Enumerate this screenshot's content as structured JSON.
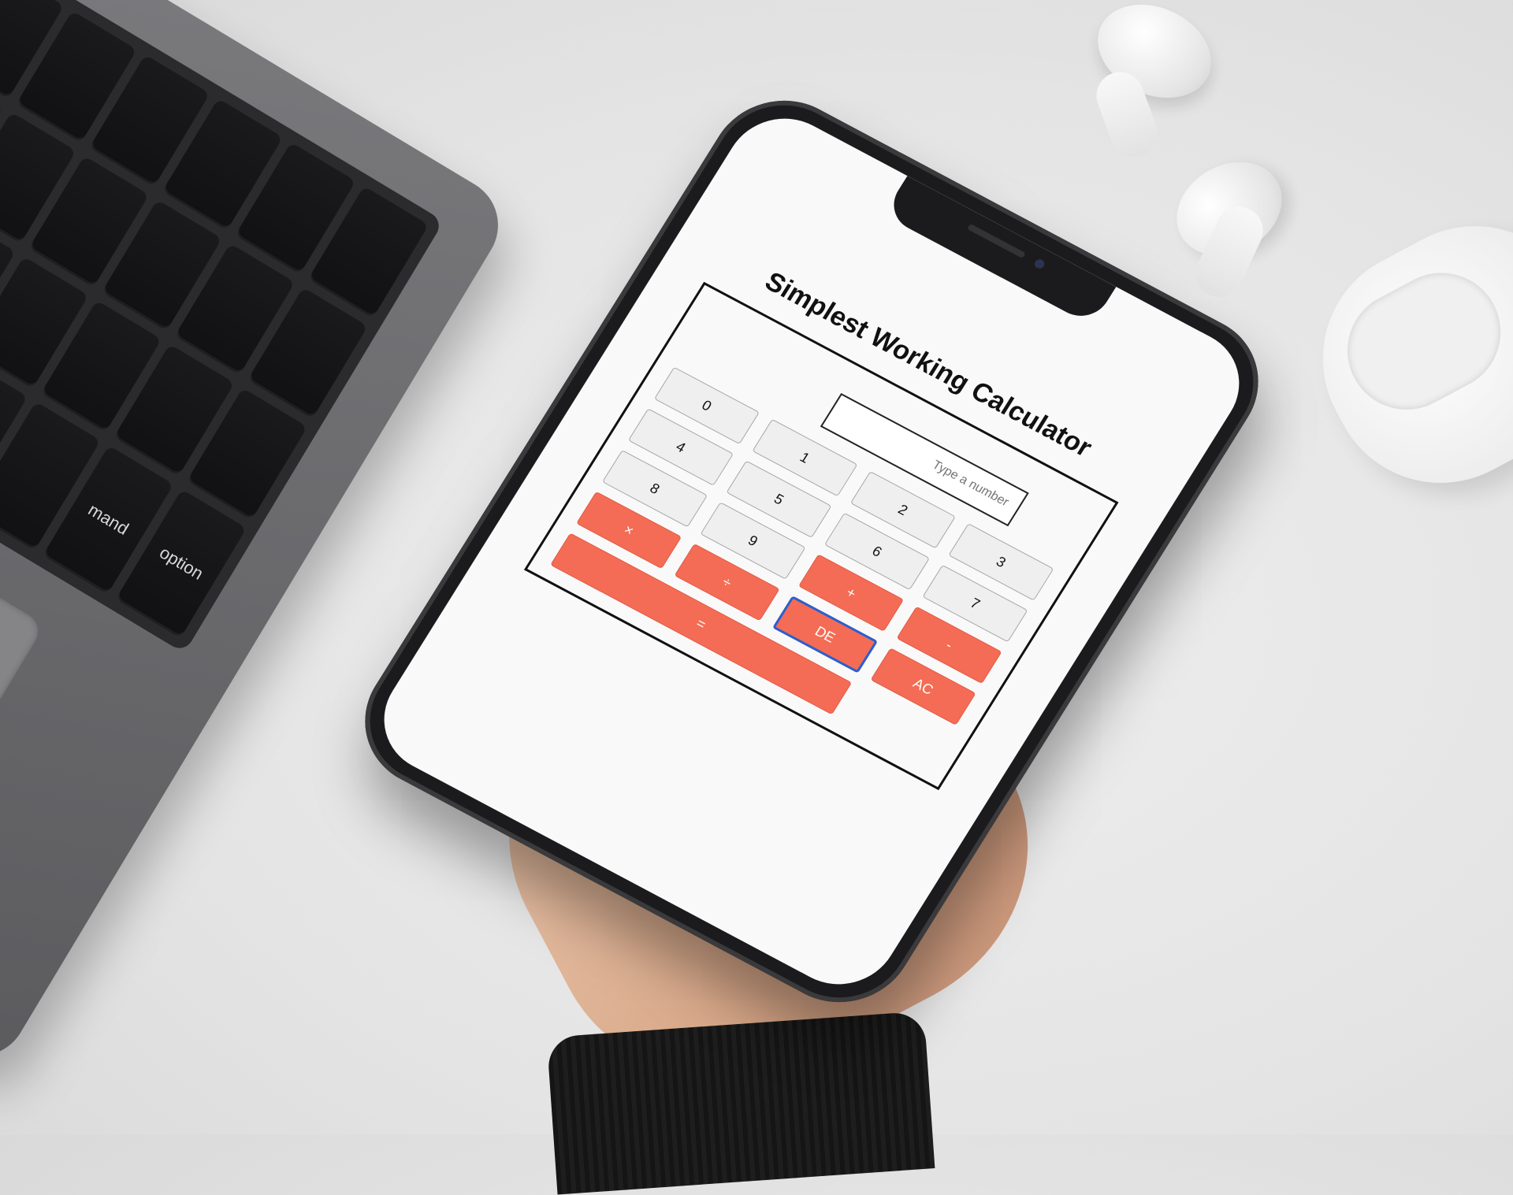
{
  "laptop": {
    "key_labels": [
      "",
      "",
      "",
      "",
      "",
      "",
      "",
      "",
      "",
      "",
      "",
      "",
      "",
      "",
      "",
      "",
      "",
      "",
      "",
      "",
      "",
      "",
      "",
      "",
      "",
      "",
      "",
      "",
      "",
      "",
      "mand",
      "option"
    ]
  },
  "calculator": {
    "title": "Simplest Working Calculator",
    "input": {
      "placeholder": "Type a number",
      "value": ""
    },
    "buttons": {
      "b0": "0",
      "b1": "1",
      "b2": "2",
      "b3": "3",
      "b4": "4",
      "b5": "5",
      "b6": "6",
      "b7": "7",
      "b8": "8",
      "b9": "9",
      "multiply": "×",
      "divide": "÷",
      "add": "+",
      "subtract": "-",
      "delete": "DE",
      "clear": "AC",
      "equals": "="
    }
  },
  "colors": {
    "operator_button": "#f46c55",
    "number_button": "#efefef",
    "focus_outline": "#2a5fd0"
  }
}
